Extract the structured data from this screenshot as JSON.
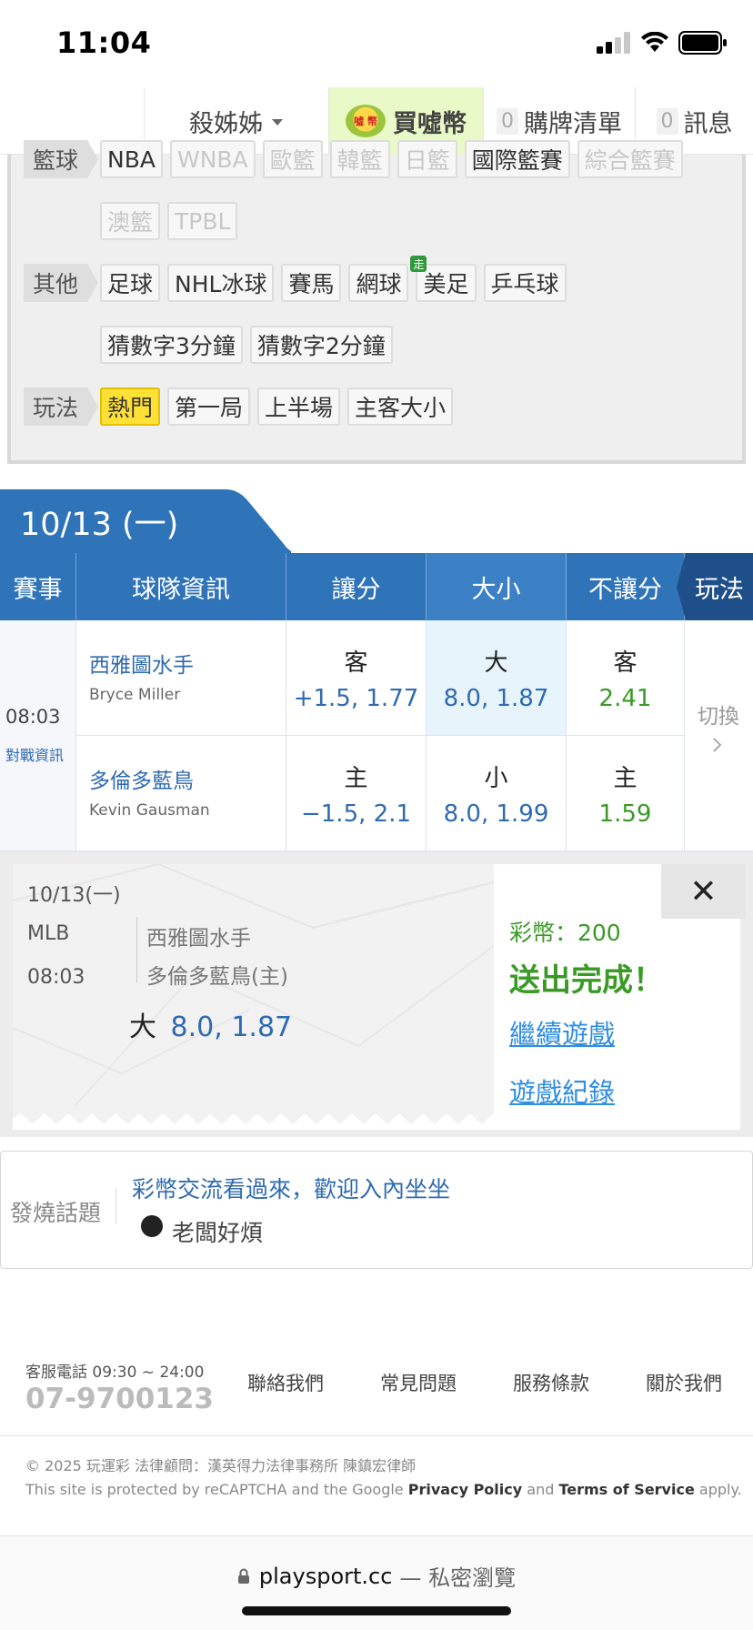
{
  "status_bar": {
    "time": "11:04"
  },
  "top_nav": {
    "username": "殺姊姊",
    "buy_label": "買噓幣",
    "buy_logo_text": "噓\n幣",
    "cart_count": "0",
    "cart_label": "購牌清單",
    "msg_count": "0",
    "msg_label": "訊息"
  },
  "filters": {
    "basketball": {
      "tag": "籃球",
      "row1": [
        "NBA",
        "WNBA",
        "歐籃",
        "韓籃",
        "日籃",
        "國際籃賽",
        "綜合籃賽"
      ],
      "row2": [
        "澳籃",
        "TPBL"
      ]
    },
    "other": {
      "tag": "其他",
      "row1": [
        "足球",
        "NHL冰球",
        "賽馬",
        "網球",
        "美足",
        "乒乓球"
      ],
      "row2": [
        "猜數字3分鐘",
        "猜數字2分鐘"
      ],
      "go_badge": "走"
    },
    "play": {
      "tag": "玩法",
      "items": [
        "熱門",
        "第一局",
        "上半場",
        "主客大小"
      ]
    }
  },
  "date_tab": "10/13 (一)",
  "table": {
    "headers": [
      "賽事",
      "球隊資訊",
      "讓分",
      "大小",
      "不讓分",
      "玩法"
    ],
    "game_time": "08:03",
    "matchup_link": "對戰資訊",
    "switch_label": "切換",
    "rows": [
      {
        "team": "西雅圖水手",
        "pitcher": "Bryce Miller",
        "spread_side": "客",
        "spread_val": "+1.5, 1.77",
        "total_side": "大",
        "total_val": "8.0, 1.87",
        "ml_side": "客",
        "ml_val": "2.41"
      },
      {
        "team": "多倫多藍鳥",
        "pitcher": "Kevin Gausman",
        "spread_side": "主",
        "spread_val": "−1.5, 2.1",
        "total_side": "小",
        "total_val": "8.0, 1.99",
        "ml_side": "主",
        "ml_val": "1.59"
      }
    ]
  },
  "ticket": {
    "date": "10/13(一)",
    "league": "MLB",
    "time": "08:03",
    "away": "西雅圖水手",
    "home": "多倫多藍鳥(主)",
    "pick_side": "大",
    "pick_val": "8.0, 1.87",
    "coins": "彩幣：200",
    "sent": "送出完成！",
    "continue_link": "繼續遊戲",
    "history_link": "遊戲紀錄",
    "close_glyph": "✕"
  },
  "hot_topic": {
    "label": "發燒話題",
    "title": "彩幣交流看過來，歡迎入內坐坐",
    "author": "老闆好煩"
  },
  "footer": {
    "phone_label": "客服電話 09:30 ~ 24:00",
    "phone": "07-9700123",
    "links": [
      "聯絡我們",
      "常見問題",
      "服務條款",
      "關於我們"
    ],
    "copyright": "© 2025 玩運彩 法律顧問：漢英得力法律事務所 陳鎮宏律師",
    "recaptcha_prefix": "This site is protected by reCAPTCHA and the Google",
    "privacy": "Privacy Policy",
    "and": "and",
    "terms": "Terms of Service",
    "apply": "apply."
  },
  "url_bar": {
    "domain": "playsport.cc",
    "mode": "— 私密瀏覽"
  },
  "colors": {
    "header_blue": "#2f73b8",
    "odds_blue": "#2f6bb0",
    "odds_green": "#3a9a25",
    "active_yellow": "#ffe135"
  }
}
